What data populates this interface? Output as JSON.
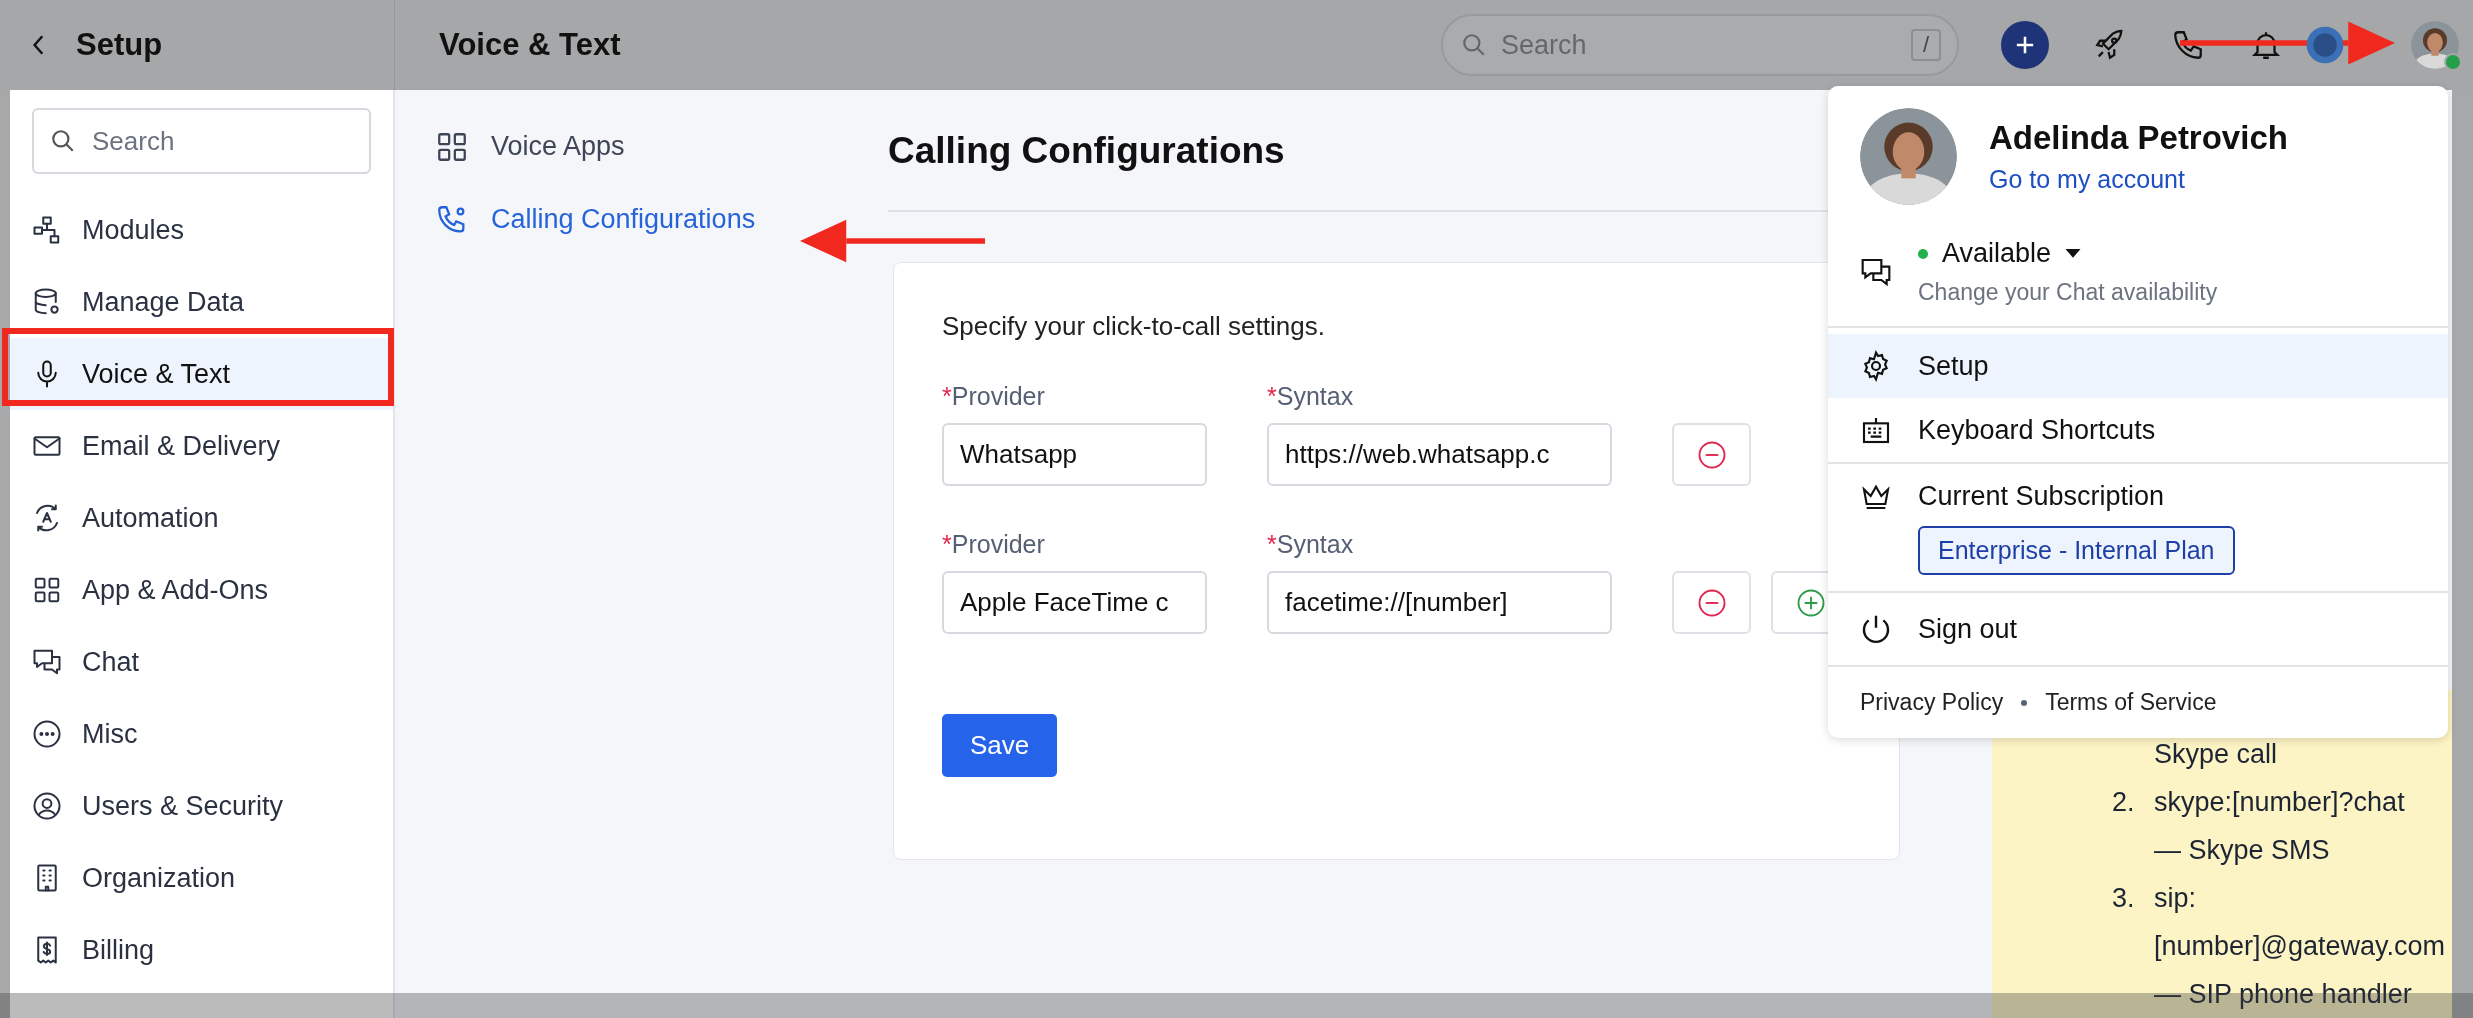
{
  "topbar": {
    "section_title": "Setup",
    "page_title": "Voice & Text",
    "search": {
      "placeholder": "Search",
      "shortcut": "/"
    },
    "user_online": true
  },
  "sidebar": {
    "search": {
      "placeholder": "Search"
    },
    "items": [
      {
        "label": "Modules",
        "selected": false
      },
      {
        "label": "Manage Data",
        "selected": false
      },
      {
        "label": "Voice & Text",
        "selected": true
      },
      {
        "label": "Email & Delivery",
        "selected": false
      },
      {
        "label": "Automation",
        "selected": false
      },
      {
        "label": "App & Add-Ons",
        "selected": false
      },
      {
        "label": "Chat",
        "selected": false
      },
      {
        "label": "Misc",
        "selected": false
      },
      {
        "label": "Users & Security",
        "selected": false
      },
      {
        "label": "Organization",
        "selected": false
      },
      {
        "label": "Billing",
        "selected": false
      }
    ]
  },
  "subnav": {
    "items": [
      {
        "label": "Voice Apps",
        "selected": false
      },
      {
        "label": "Calling Configurations",
        "selected": true
      }
    ]
  },
  "content": {
    "title": "Calling Configurations",
    "intro": "Specify your click-to-call settings.",
    "rows": [
      {
        "fields": [
          {
            "label": "Provider",
            "required_mark": "*",
            "value": "Whatsapp"
          },
          {
            "label": "Syntax",
            "required_mark": "*",
            "value": "https://web.whatsapp.c"
          }
        ],
        "actions": [
          {
            "kind": "remove"
          }
        ]
      },
      {
        "fields": [
          {
            "label": "Provider",
            "required_mark": "*",
            "value": "Apple FaceTime c"
          },
          {
            "label": "Syntax",
            "required_mark": "*",
            "value": "facetime://[number]"
          }
        ],
        "actions": [
          {
            "kind": "remove"
          },
          {
            "kind": "add"
          }
        ]
      }
    ],
    "save": "Save"
  },
  "note": {
    "items": [
      {
        "lines": [
          "Skype call"
        ]
      },
      {
        "number": "2.",
        "lines": [
          "skype:[number]?chat",
          "— Skype SMS"
        ]
      },
      {
        "number": "3.",
        "lines": [
          "sip:",
          "[number]@gateway.com",
          "— SIP phone handler"
        ]
      }
    ]
  },
  "menu": {
    "user": {
      "name": "Adelinda Petrovich",
      "link": "Go to my account"
    },
    "status": {
      "label": "Available",
      "online": true,
      "caption": "Change your Chat availability"
    },
    "items": [
      {
        "label": "Setup",
        "selected": true
      },
      {
        "label": "Keyboard Shortcuts",
        "selected": false
      }
    ],
    "subscription": {
      "label": "Current Subscription",
      "plan": "Enterprise - Internal Plan"
    },
    "sign_out": "Sign out",
    "footer": [
      "Privacy Policy",
      "Terms of Service"
    ]
  }
}
